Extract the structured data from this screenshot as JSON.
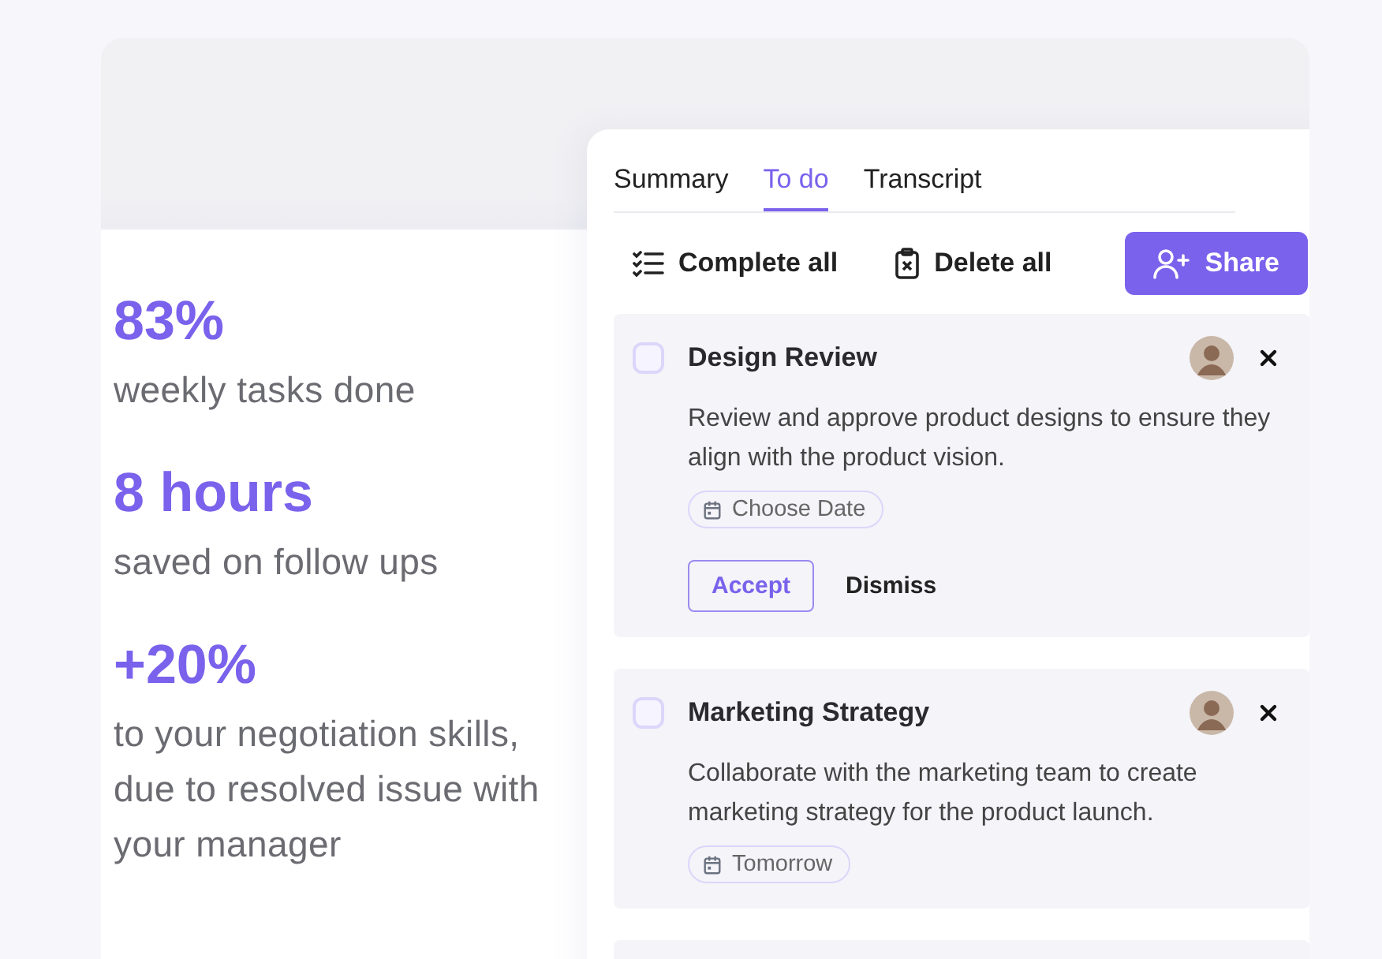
{
  "stats": [
    {
      "value": "83%",
      "label": "weekly tasks done"
    },
    {
      "value": "8 hours",
      "label": "saved on follow ups"
    },
    {
      "value": "+20%",
      "label": "to your negotiation skills, due to resolved issue with your manager"
    }
  ],
  "tabs": [
    {
      "label": "Summary",
      "selected": false
    },
    {
      "label": "To do",
      "selected": true
    },
    {
      "label": "Transcript",
      "selected": false
    }
  ],
  "toolbar": [
    {
      "kind": "complete",
      "label": "Complete all"
    },
    {
      "kind": "delete",
      "label": "Delete all"
    },
    {
      "kind": "share",
      "label": "Share"
    }
  ],
  "tasks": [
    {
      "title": "Design Review",
      "checked": false,
      "description": "Review and approve product designs to ensure they align with the product vision.",
      "date": "Choose Date",
      "actions": [
        {
          "kind": "outline",
          "label": "Accept"
        },
        {
          "kind": "text",
          "label": "Dismiss"
        }
      ]
    },
    {
      "title": "Marketing Strategy",
      "checked": false,
      "description": "Collaborate with the marketing team to create marketing strategy for the product launch.",
      "date": "Tomorrow"
    }
  ]
}
